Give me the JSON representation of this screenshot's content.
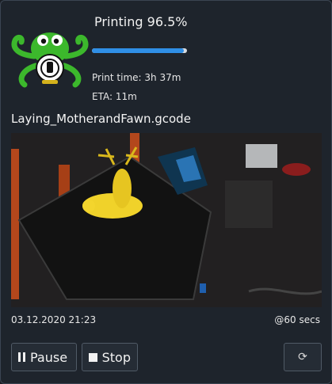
{
  "status": {
    "label": "Printing 96.5%",
    "progress_percent": 96.5,
    "print_time": "Print time: 3h 37m",
    "eta": "ETA: 11m"
  },
  "file": {
    "name": "Laying_MotherandFawn.gcode"
  },
  "webcam": {
    "timestamp": "03.12.2020 21:23",
    "interval": "@60 secs"
  },
  "controls": {
    "pause_label": "Pause",
    "stop_label": "Stop",
    "refresh_icon": "refresh-icon"
  },
  "colors": {
    "accent": "#2f8fe6",
    "logo_green": "#3cb82c",
    "background": "#1e242c"
  }
}
